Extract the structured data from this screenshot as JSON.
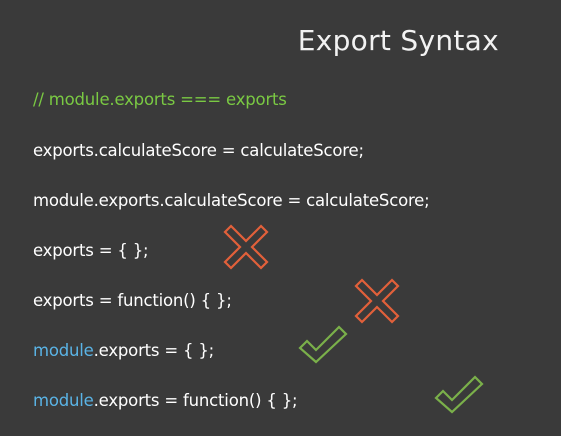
{
  "slide": {
    "title": "Export Syntax",
    "comment": "// module.exports === exports",
    "lines": [
      {
        "text": "exports.calculateScore = calculateScore;"
      },
      {
        "text": "module.exports.calculateScore = calculateScore;"
      },
      {
        "text": "exports = { };",
        "result": "cross-icon"
      },
      {
        "text": "exports = function() { };",
        "result": "cross-icon"
      },
      {
        "prefix": "module",
        "text": ".exports = { };",
        "result": "check-icon"
      },
      {
        "prefix": "module",
        "text": ".exports = function() { };",
        "result": "check-icon"
      }
    ]
  },
  "colors": {
    "background": "#3a3a3a",
    "comment": "#7ac943",
    "keyword": "#5ab4e6",
    "cross": "#e2603a",
    "check": "#7ab04a"
  }
}
